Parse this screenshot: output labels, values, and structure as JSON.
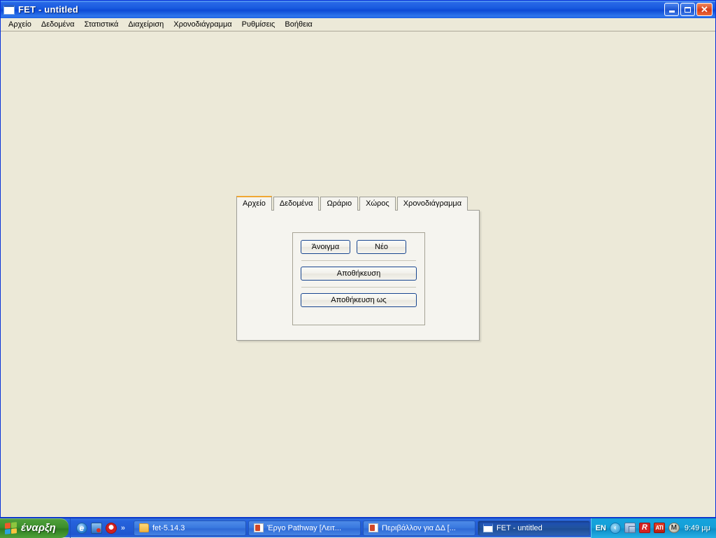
{
  "window": {
    "title": "FET - untitled",
    "icon": "window-icon",
    "controls": {
      "minimize": "minimize-button",
      "maximize": "maximize-button",
      "close": "close-button",
      "close_glyph": "✕"
    }
  },
  "menubar": {
    "items": [
      {
        "label": "Αρχείο"
      },
      {
        "label": "Δεδομένα"
      },
      {
        "label": "Στατιστικά"
      },
      {
        "label": "Διαχείριση"
      },
      {
        "label": "Χρονοδιάγραμμα"
      },
      {
        "label": "Ρυθμίσεις"
      },
      {
        "label": "Βοήθεια"
      }
    ]
  },
  "dialog": {
    "tabs": [
      {
        "label": "Αρχείο",
        "active": true
      },
      {
        "label": "Δεδομένα",
        "active": false
      },
      {
        "label": "Ωράριο",
        "active": false
      },
      {
        "label": "Χώρος",
        "active": false
      },
      {
        "label": "Χρονοδιάγραμμα",
        "active": false
      }
    ],
    "file_panel": {
      "open_label": "Άνοιγμα",
      "new_label": "Νέο",
      "save_label": "Αποθήκευση",
      "save_as_label": "Αποθήκευση ως"
    }
  },
  "taskbar": {
    "start_label": "έναρξη",
    "quicklaunch": {
      "overflow_glyph": "»",
      "items": [
        {
          "name": "internet-explorer-icon"
        },
        {
          "name": "frontpage-icon"
        },
        {
          "name": "antivirus-icon"
        }
      ]
    },
    "tasks": [
      {
        "label": "fet-5.14.3",
        "icon": "folder-icon",
        "active": false
      },
      {
        "label": "Έργο Pathway [Λειτ...",
        "icon": "powerpoint-icon",
        "active": false
      },
      {
        "label": "Περιβάλλον για ΔΔ [...",
        "icon": "powerpoint-icon",
        "active": false
      },
      {
        "label": "FET - untitled",
        "icon": "window-icon",
        "active": true
      }
    ],
    "tray": {
      "language": "EN",
      "chevron_glyph": "‹",
      "icons": [
        {
          "name": "network-icon",
          "text": ""
        },
        {
          "name": "avira-antivirus-icon",
          "text": "R"
        },
        {
          "name": "ati-catalyst-icon",
          "text": "ATI"
        },
        {
          "name": "msn-icon",
          "text": "M"
        }
      ],
      "clock": "9:49 μμ"
    }
  },
  "colors": {
    "accent_orange": "#f0a732",
    "titlebar_blue": "#1b5ce0",
    "desktop_beige": "#ece9d8",
    "button_border": "#17458f"
  }
}
